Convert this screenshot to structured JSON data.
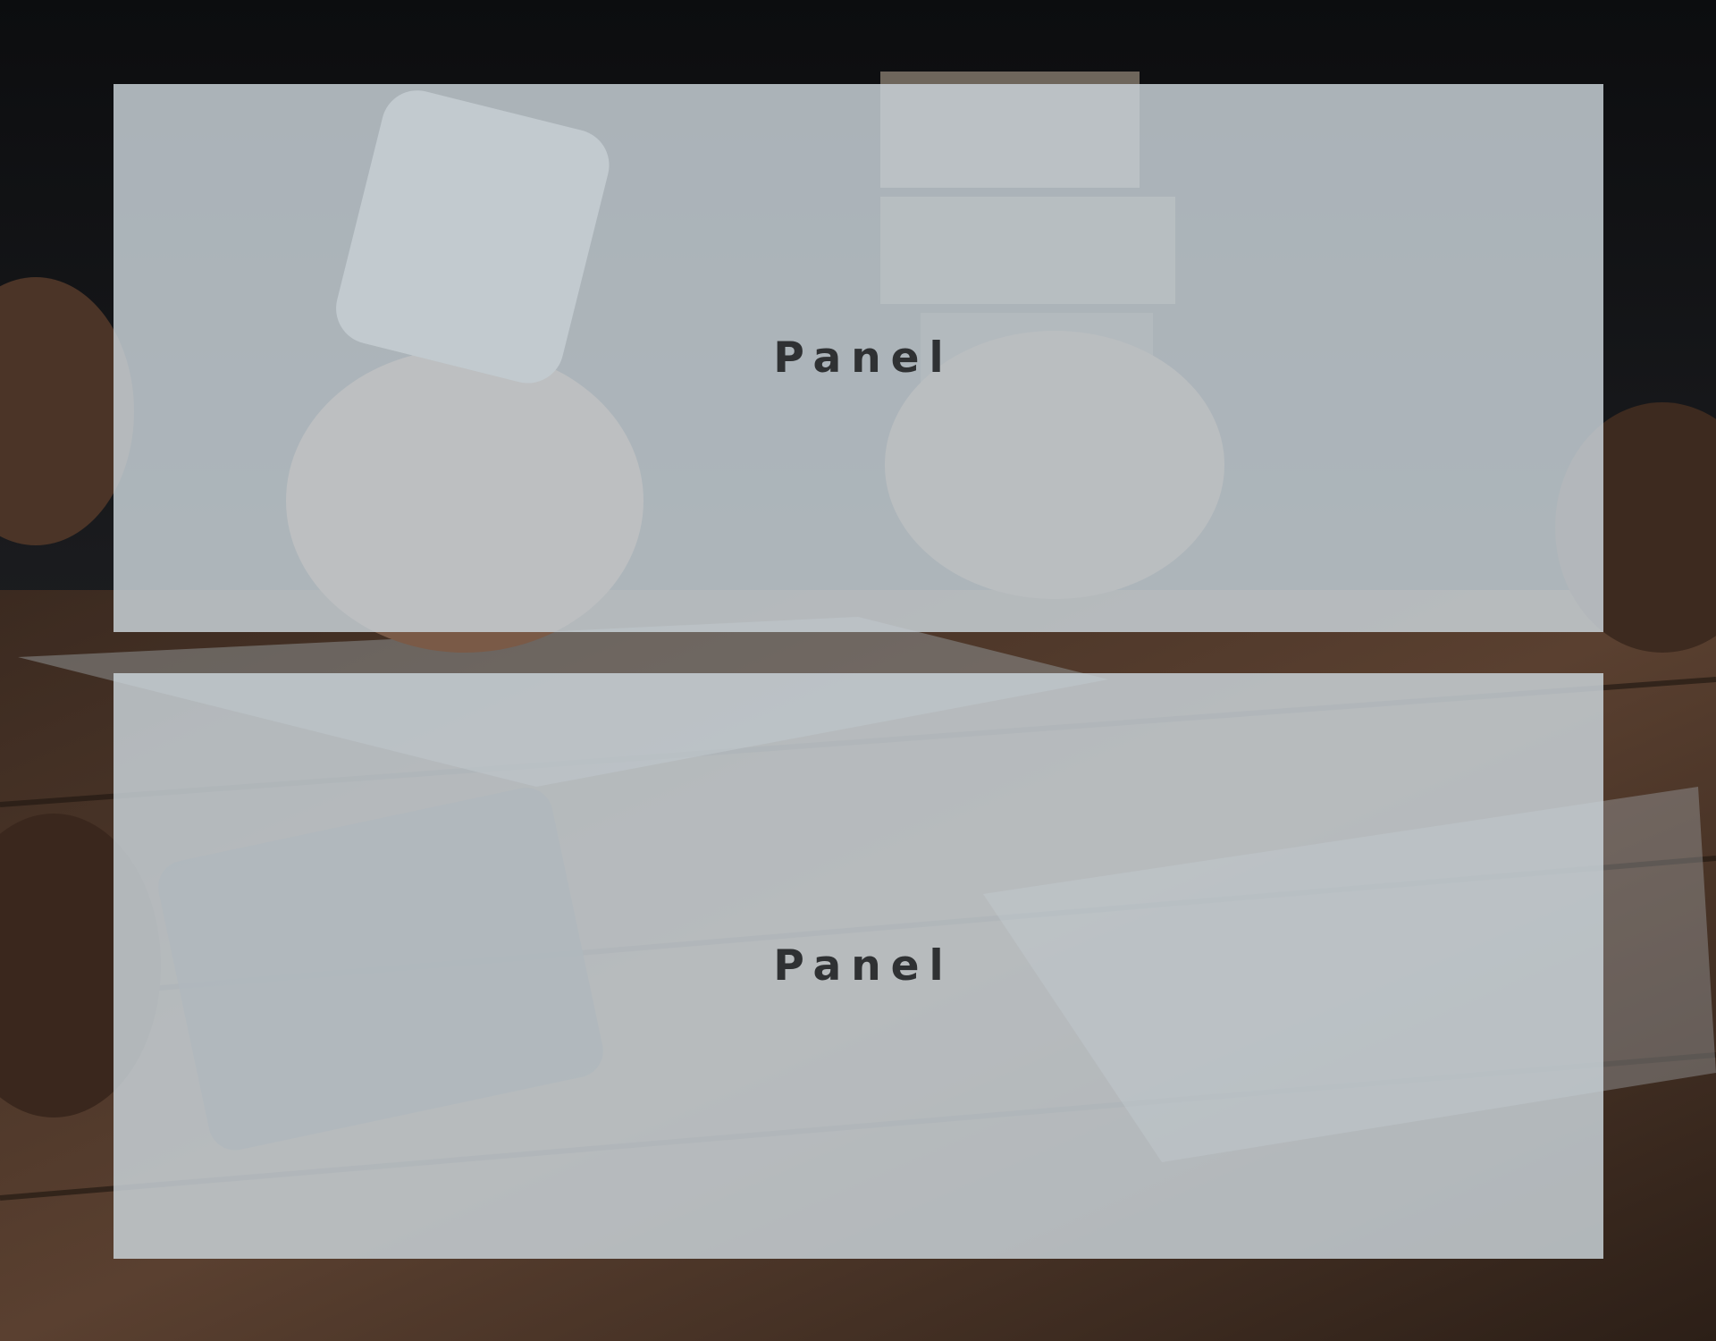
{
  "panels": [
    {
      "label": "Panel"
    },
    {
      "label": "Panel"
    }
  ],
  "background": {
    "image": "desk-meeting-photo",
    "colors": {
      "base": "#0b0c0d",
      "wood": "#4a3528",
      "overlay": "#c9d3d9",
      "text": "#2f3133"
    }
  }
}
